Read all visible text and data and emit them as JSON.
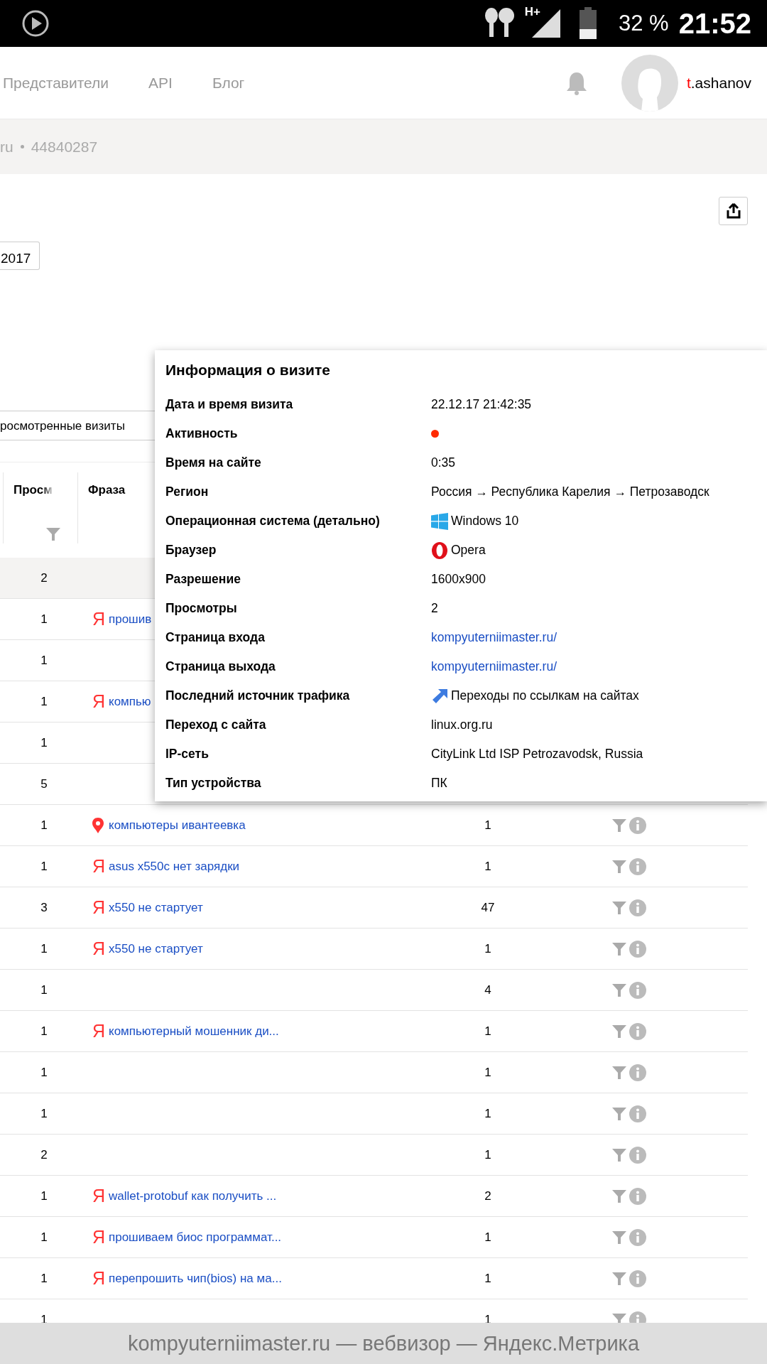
{
  "status_bar": {
    "network": "H+",
    "battery": "32 %",
    "time": "21:52"
  },
  "header": {
    "nav": [
      "Представители",
      "API",
      "Блог"
    ],
    "user": {
      "initial": "t",
      "rest": ".ashanov"
    }
  },
  "counter_bar": {
    "site": "ru",
    "counter_id": "44840287"
  },
  "date_button": "2017",
  "filter_select": "росмотренные визиты",
  "table": {
    "columns": [
      "Просм",
      "Фраза"
    ],
    "rows": [
      {
        "selected": true,
        "views": "2"
      },
      {
        "selected": false,
        "views": "1",
        "source": {
          "kind": "yandex",
          "glyph": "Я"
        },
        "phrase": "прошив"
      },
      {
        "selected": false,
        "views": "1"
      },
      {
        "selected": false,
        "views": "1",
        "source": {
          "kind": "yandex",
          "glyph": "Я"
        },
        "phrase": "компью"
      },
      {
        "selected": false,
        "views": "1"
      },
      {
        "selected": false,
        "views": "5"
      },
      {
        "selected": false,
        "views": "1",
        "source": {
          "kind": "pin"
        },
        "phrase": "компьютеры ивантеевка",
        "visits": "1"
      },
      {
        "selected": false,
        "views": "1",
        "source": {
          "kind": "yandex",
          "glyph": "Я"
        },
        "phrase": "asus x550c нет зарядки",
        "visits": "1"
      },
      {
        "selected": false,
        "views": "3",
        "source": {
          "kind": "yandex",
          "glyph": "Я"
        },
        "phrase": "x550 не стартует",
        "visits": "47"
      },
      {
        "selected": false,
        "views": "1",
        "source": {
          "kind": "yandex",
          "glyph": "Я"
        },
        "phrase": "x550 не стартует",
        "visits": "1"
      },
      {
        "selected": false,
        "views": "1",
        "visits": "4"
      },
      {
        "selected": false,
        "views": "1",
        "source": {
          "kind": "yandex",
          "glyph": "Я"
        },
        "phrase": "компьютерный мошенник ди...",
        "visits": "1"
      },
      {
        "selected": false,
        "views": "1",
        "visits": "1"
      },
      {
        "selected": false,
        "views": "1",
        "visits": "1"
      },
      {
        "selected": false,
        "views": "2",
        "visits": "1"
      },
      {
        "selected": false,
        "views": "1",
        "source": {
          "kind": "yandex",
          "glyph": "Я"
        },
        "phrase": "wallet-protobuf как получить ...",
        "visits": "2"
      },
      {
        "selected": false,
        "views": "1",
        "source": {
          "kind": "yandex",
          "glyph": "Я"
        },
        "phrase": "прошиваем биос программат...",
        "visits": "1"
      },
      {
        "selected": false,
        "views": "1",
        "source": {
          "kind": "yandex",
          "glyph": "Я"
        },
        "phrase": "перепрошить чип(bios) на ма...",
        "visits": "1"
      },
      {
        "selected": false,
        "views": "1",
        "visits": "1"
      }
    ]
  },
  "visit_popup": {
    "title": "Информация о визите",
    "fields": [
      {
        "label": "Дата и время визита",
        "kind": "text",
        "value": "22.12.17 21:42:35"
      },
      {
        "label": "Активность",
        "kind": "dot",
        "color": "#ff2a00"
      },
      {
        "label": "Время на сайте",
        "kind": "text",
        "value": "0:35"
      },
      {
        "label": "Регион",
        "kind": "text",
        "value": "Россия → Республика Карелия → Петрозаводск"
      },
      {
        "label": "Операционная система (детально)",
        "kind": "windows",
        "value": "Windows 10"
      },
      {
        "label": "Браузер",
        "kind": "opera",
        "value": "Opera"
      },
      {
        "label": "Разрешение",
        "kind": "text",
        "value": "1600x900"
      },
      {
        "label": "Просмотры",
        "kind": "text",
        "value": "2"
      },
      {
        "label": "Страница входа",
        "kind": "link",
        "value": "kompyuterniimaster.ru/"
      },
      {
        "label": "Страница выхода",
        "kind": "link",
        "value": "kompyuterniimaster.ru/"
      },
      {
        "label": "Последний источник трафика",
        "kind": "referral",
        "value": "Переходы по ссылкам на сайтах"
      },
      {
        "label": "Переход с сайта",
        "kind": "text",
        "value": "linux.org.ru"
      },
      {
        "label": "IP-сеть",
        "kind": "text",
        "value": "CityLink Ltd ISP Petrozavodsk, Russia"
      },
      {
        "label": "Тип устройства",
        "kind": "text",
        "value": "ПК"
      }
    ]
  },
  "footer_bar": "kompyuterniimaster.ru — вебвизор — Яндекс.Метрика"
}
